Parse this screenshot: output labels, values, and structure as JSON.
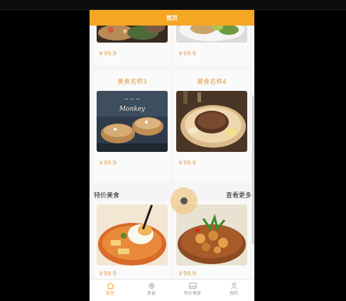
{
  "header": {
    "title": "首页"
  },
  "top_cards": [
    {
      "title": "",
      "price": "￥99.9"
    },
    {
      "title": "",
      "price": "￥99.9"
    }
  ],
  "cards": [
    {
      "title": "美食名称3",
      "price": "￥99.9",
      "image_text": "Monkey"
    },
    {
      "title": "美食名称4",
      "price": "￥99.9"
    }
  ],
  "section": {
    "title": "特价美食",
    "more": "查看更多"
  },
  "special_cards": [
    {
      "price": "￥99.9"
    },
    {
      "price": "￥99.9"
    }
  ],
  "tabs": [
    {
      "label": "首页",
      "icon": "home-icon",
      "active": true
    },
    {
      "label": "美食",
      "icon": "flower-icon",
      "active": false
    },
    {
      "label": "特价美食",
      "icon": "image-icon",
      "active": false
    },
    {
      "label": "我的",
      "icon": "user-icon",
      "active": false
    }
  ],
  "colors": {
    "accent": "#f5a623",
    "price": "#e0a050"
  }
}
